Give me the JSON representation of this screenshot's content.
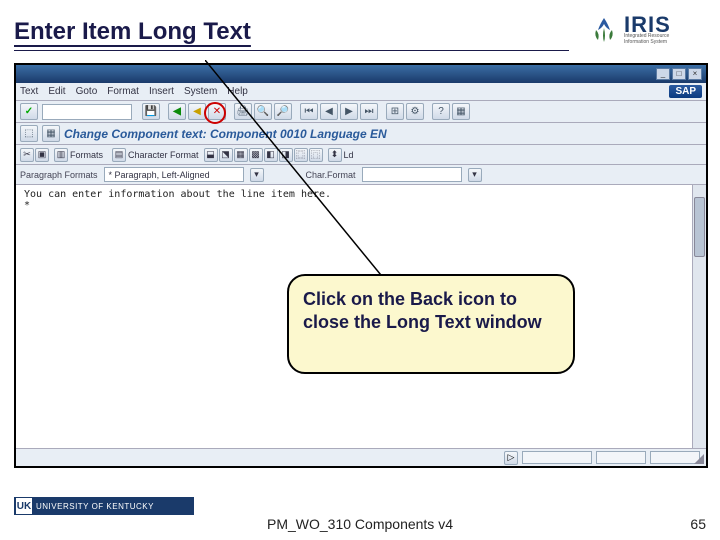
{
  "slide": {
    "title": "Enter Item Long Text",
    "footer": "PM_WO_310 Components v4",
    "page_number": "65"
  },
  "logos": {
    "iris_name": "IRIS",
    "iris_tagline1": "Integrated Resource",
    "iris_tagline2": "Information System",
    "uk_badge": "UK",
    "uk_name": "UNIVERSITY OF KENTUCKY",
    "sap": "SAP"
  },
  "sap": {
    "menu": {
      "text": "Text",
      "edit": "Edit",
      "goto": "Goto",
      "format": "Format",
      "insert": "Insert",
      "system": "System",
      "help": "Help"
    },
    "subtitle": "Change Component text: Component 0010 Language EN",
    "toolbar2": {
      "formats": "Formats",
      "char_format": "Character Format",
      "load": "Ld"
    },
    "fields": {
      "para_label": "Paragraph Formats",
      "para_value": "* Paragraph, Left-Aligned",
      "char_label": "Char.Format"
    },
    "editor_line": "You  can  enter  information about the line  item  here."
  },
  "callout": {
    "text": "Click on the Back icon to close the Long Text window"
  },
  "semantics": {
    "back_icon_name": "back-icon"
  }
}
